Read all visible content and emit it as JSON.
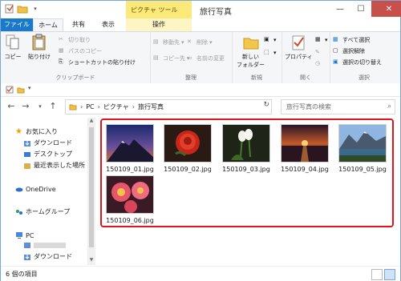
{
  "window": {
    "title": "旅行写真",
    "context_tab_header": "ピクチャ ツール"
  },
  "tabs": {
    "file": "ファイル",
    "home": "ホーム",
    "share": "共有",
    "view": "表示",
    "manage": "操作"
  },
  "ribbon": {
    "clipboard": {
      "copy": "コピー",
      "paste": "貼り付け",
      "cut": "切り取り",
      "copy_path": "パスのコピー",
      "paste_shortcut": "ショートカットの貼り付け",
      "label": "クリップボード"
    },
    "organize": {
      "move_to": "移動先",
      "copy_to": "コピー先",
      "delete": "削除",
      "rename": "名前の変更",
      "label": "整理"
    },
    "new": {
      "new_folder_line1": "新しい",
      "new_folder_line2": "フォルダー",
      "label": "新規"
    },
    "open": {
      "properties": "プロパティ",
      "label": "開く"
    },
    "select": {
      "select_all": "すべて選択",
      "select_none": "選択解除",
      "invert": "選択の切り替え",
      "label": "選択"
    }
  },
  "address": {
    "crumbs": [
      "PC",
      "ピクチャ",
      "旅行写真"
    ],
    "search_placeholder": "旅行写真の検索"
  },
  "nav": {
    "favorites": "お気に入り",
    "downloads": "ダウンロード",
    "desktop": "デスクトップ",
    "recent": "最近表示した場所",
    "onedrive": "OneDrive",
    "homegroup": "ホームグループ",
    "pc": "PC",
    "downloads2": "ダウンロード"
  },
  "files": [
    {
      "name": "150109_01.jpg",
      "subject": "mountain-sunset"
    },
    {
      "name": "150109_02.jpg",
      "subject": "red-rose"
    },
    {
      "name": "150109_03.jpg",
      "subject": "white-flowers"
    },
    {
      "name": "150109_04.jpg",
      "subject": "sunset-sea"
    },
    {
      "name": "150109_05.jpg",
      "subject": "mountain-lake"
    },
    {
      "name": "150109_06.jpg",
      "subject": "pink-flowers"
    }
  ],
  "status": {
    "count": "6 個の項目"
  },
  "colors": {
    "accent": "#1979ca",
    "highlight": "#e3151a",
    "context_tab": "#fbe97a"
  }
}
